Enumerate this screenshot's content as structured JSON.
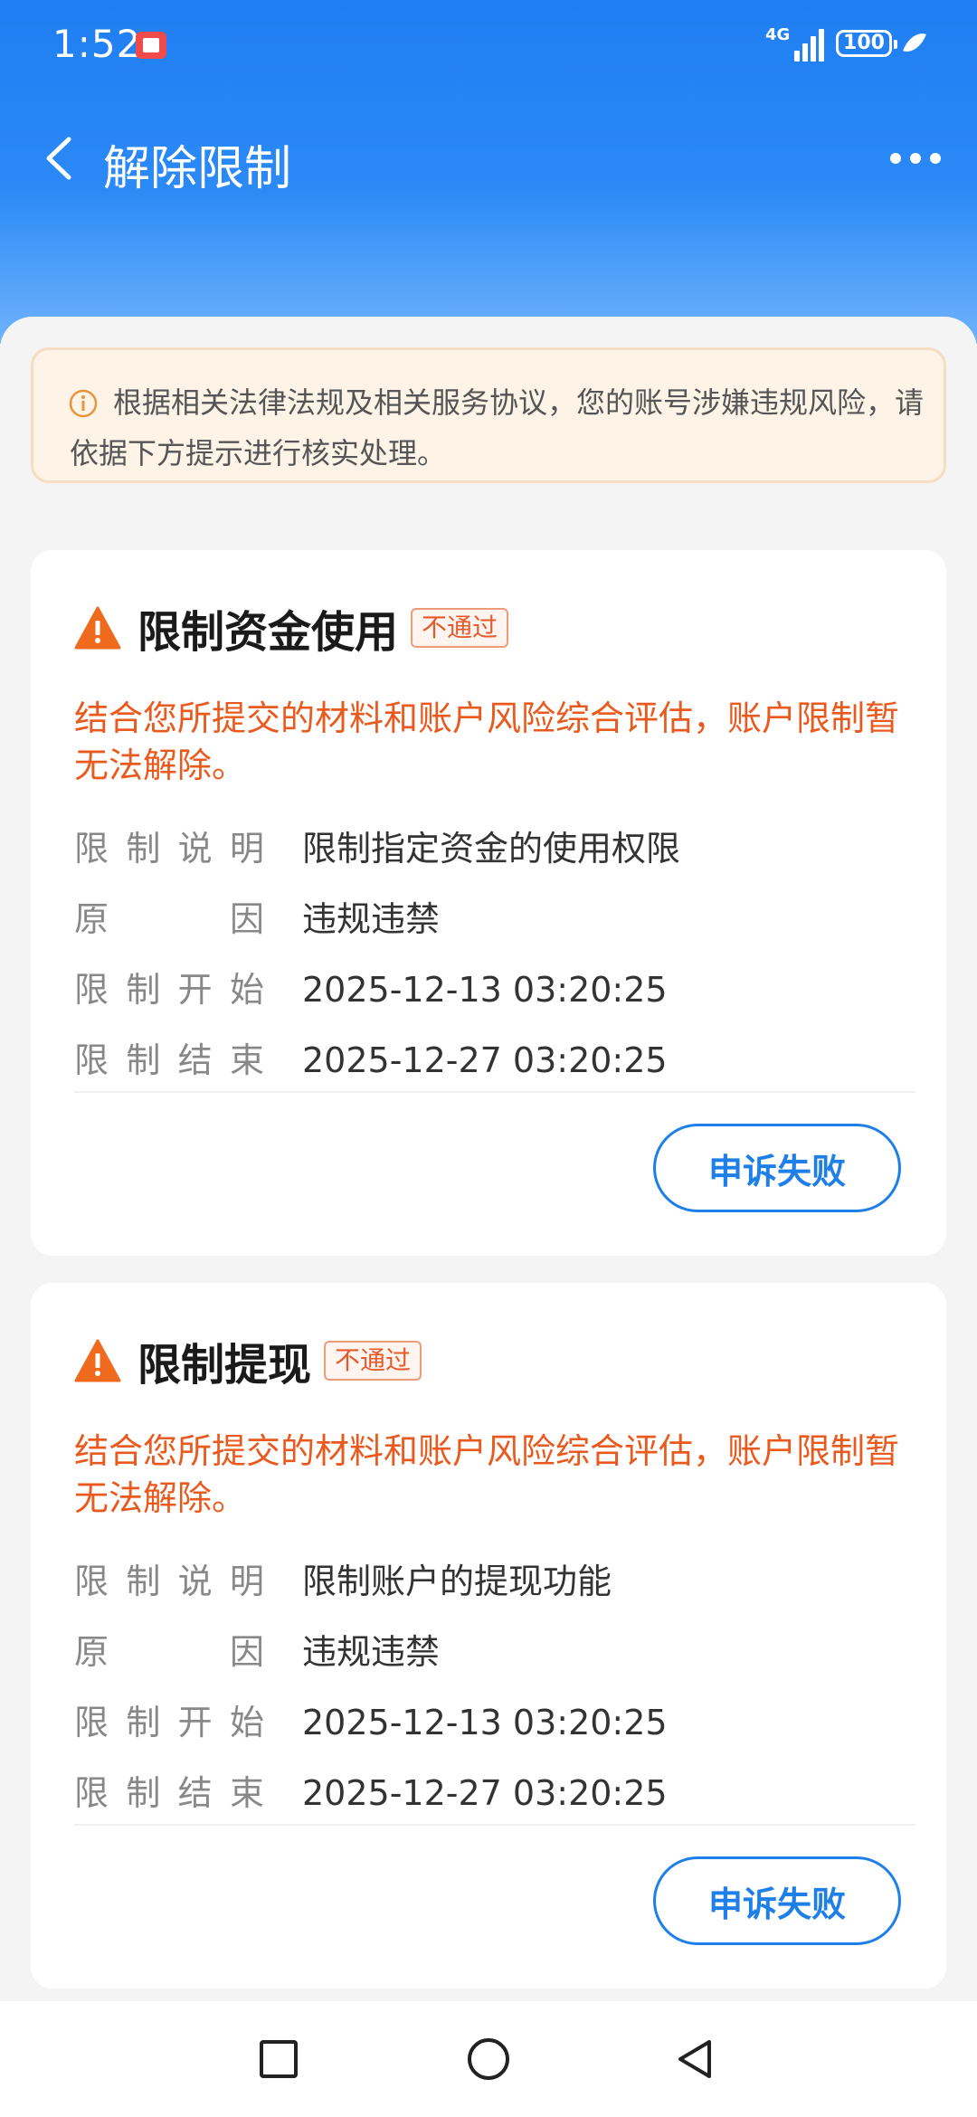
{
  "status_bar": {
    "time": "1:52",
    "network": "4G",
    "battery": "100"
  },
  "nav": {
    "title": "解除限制"
  },
  "notice": {
    "text": "根据相关法律法规及相关服务协议，您的账号涉嫌违规风险，请依据下方提示进行核实处理。"
  },
  "labels": {
    "desc": [
      "限",
      "制",
      "说",
      "明"
    ],
    "reason": [
      "原",
      "因"
    ],
    "start": [
      "限",
      "制",
      "开",
      "始"
    ],
    "end": [
      "限",
      "制",
      "结",
      "束"
    ]
  },
  "cards": [
    {
      "title": "限制资金使用",
      "badge": "不通过",
      "message": "结合您所提交的材料和账户风险综合评估，账户限制暂无法解除。",
      "description": "限制指定资金的使用权限",
      "reason": "违规违禁",
      "start": "2025-12-13 03:20:25",
      "end": "2025-12-27 03:20:25",
      "button": "申诉失败"
    },
    {
      "title": "限制提现",
      "badge": "不通过",
      "message": "结合您所提交的材料和账户风险综合评估，账户限制暂无法解除。",
      "description": "限制账户的提现功能",
      "reason": "违规违禁",
      "start": "2025-12-13 03:20:25",
      "end": "2025-12-27 03:20:25",
      "button": "申诉失败"
    }
  ],
  "colors": {
    "primary": "#1e7fe8",
    "warning": "#ea5a1e",
    "notice_bg": "#fdf3e7"
  },
  "icons": {
    "back": "back-arrow-icon",
    "more": "more-icon",
    "info": "info-icon",
    "warning": "warning-icon",
    "recents": "square-icon",
    "home": "circle-icon",
    "system_back": "triangle-back-icon"
  }
}
